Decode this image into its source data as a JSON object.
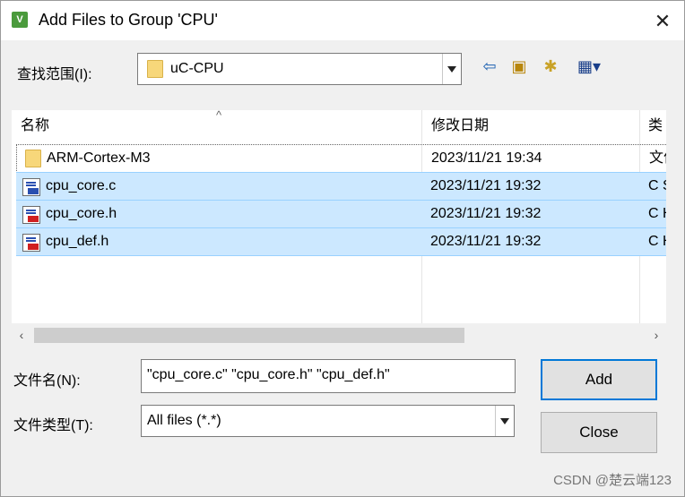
{
  "window": {
    "title": "Add Files to Group 'CPU'",
    "app_icon_glyph": "V"
  },
  "look_in": {
    "label": "查找范围(I):",
    "value": "uC-CPU"
  },
  "columns": {
    "name": "名称",
    "date": "修改日期",
    "type": "类型"
  },
  "files": [
    {
      "name": "ARM-Cortex-M3",
      "date": "2023/11/21 19:34",
      "type": "文件夹",
      "icon": "folder-icon",
      "selected": false
    },
    {
      "name": "cpu_core.c",
      "date": "2023/11/21 19:32",
      "type": "C Source file",
      "icon": "c-source-file-icon",
      "selected": true
    },
    {
      "name": "cpu_core.h",
      "date": "2023/11/21 19:32",
      "type": "C Header file",
      "icon": "c-header-file-icon",
      "selected": true
    },
    {
      "name": "cpu_def.h",
      "date": "2023/11/21 19:32",
      "type": "C Header file",
      "icon": "c-header-file-icon",
      "selected": true
    }
  ],
  "filename": {
    "label": "文件名(N):",
    "value": "\"cpu_core.c\" \"cpu_core.h\" \"cpu_def.h\""
  },
  "filetype": {
    "label": "文件类型(T):",
    "value": "All files (*.*)"
  },
  "buttons": {
    "add": "Add",
    "close": "Close"
  },
  "watermark": "CSDN @楚云端123",
  "colors": {
    "selection": "#cce8ff",
    "accent": "#0078d7",
    "dialog_bg": "#f0f0f0"
  }
}
